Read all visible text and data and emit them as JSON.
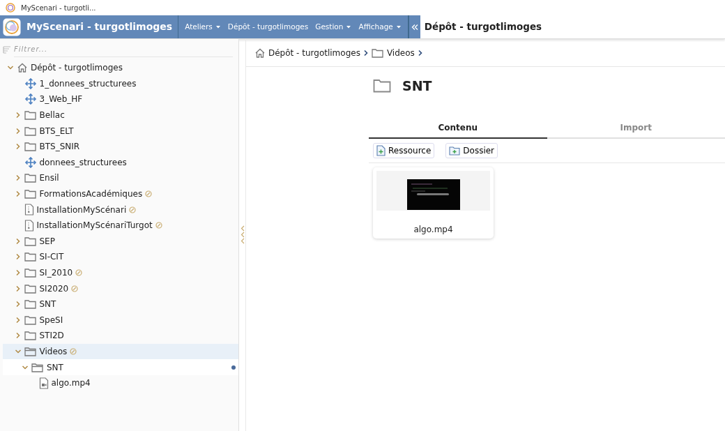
{
  "browser_tab": {
    "title": "MyScenari - turgotli..."
  },
  "header": {
    "app_title": "MyScenari - turgotlimoges",
    "menu": [
      {
        "label": "Ateliers",
        "dropdown": true
      },
      {
        "label": "Dépôt - turgotlimoges",
        "dropdown": false
      },
      {
        "label": "Gestion",
        "dropdown": true
      },
      {
        "label": "Affichage",
        "dropdown": true
      }
    ],
    "page_title": "Dépôt - turgotlimoges"
  },
  "sidebar": {
    "filter": {
      "placeholder": "Filtrer..."
    },
    "tree": [
      {
        "label": "Dépôt - turgotlimoges",
        "kind": "home",
        "expanded": true,
        "selected": false,
        "edited": false,
        "current": false,
        "children": [
          {
            "label": "1_donnees_structurees",
            "kind": "space",
            "selected": false,
            "edited": false,
            "current": false
          },
          {
            "label": "3_Web_HF",
            "kind": "space",
            "selected": false,
            "edited": false,
            "current": false
          },
          {
            "label": "Bellac",
            "kind": "folder",
            "expanded": false,
            "selected": false,
            "edited": false,
            "current": false
          },
          {
            "label": "BTS_ELT",
            "kind": "folder",
            "expanded": false,
            "selected": false,
            "edited": false,
            "current": false
          },
          {
            "label": "BTS_SNIR",
            "kind": "folder",
            "expanded": false,
            "selected": false,
            "edited": false,
            "current": false
          },
          {
            "label": "donnees_structurees",
            "kind": "space",
            "selected": false,
            "edited": false,
            "current": false
          },
          {
            "label": "Ensil",
            "kind": "folder",
            "expanded": false,
            "selected": false,
            "edited": false,
            "current": false
          },
          {
            "label": "FormationsAcadémiques",
            "kind": "folder",
            "expanded": false,
            "selected": false,
            "edited": true,
            "current": false
          },
          {
            "label": "InstallationMyScénari",
            "kind": "document",
            "selected": false,
            "edited": true,
            "current": false
          },
          {
            "label": "InstallationMyScénariTurgot",
            "kind": "document",
            "selected": false,
            "edited": true,
            "current": false
          },
          {
            "label": "SEP",
            "kind": "folder",
            "expanded": false,
            "selected": false,
            "edited": false,
            "current": false
          },
          {
            "label": "SI-CIT",
            "kind": "folder",
            "expanded": false,
            "selected": false,
            "edited": false,
            "current": false
          },
          {
            "label": "SI_2010",
            "kind": "folder",
            "expanded": false,
            "selected": false,
            "edited": true,
            "current": false
          },
          {
            "label": "SI2020",
            "kind": "folder",
            "expanded": false,
            "selected": false,
            "edited": true,
            "current": false
          },
          {
            "label": "SNT",
            "kind": "folder",
            "expanded": false,
            "selected": false,
            "edited": false,
            "current": false
          },
          {
            "label": "SpeSI",
            "kind": "folder",
            "expanded": false,
            "selected": false,
            "edited": false,
            "current": false
          },
          {
            "label": "STI2D",
            "kind": "folder",
            "expanded": false,
            "selected": false,
            "edited": false,
            "current": false
          },
          {
            "label": "Videos",
            "kind": "folder",
            "expanded": true,
            "selected": true,
            "edited": true,
            "current": false,
            "children": [
              {
                "label": "SNT",
                "kind": "folder",
                "expanded": true,
                "selected": false,
                "edited": false,
                "current": true,
                "children": [
                  {
                    "label": "algo.mp4",
                    "kind": "video",
                    "selected": false,
                    "edited": false,
                    "current": false
                  }
                ]
              }
            ]
          }
        ]
      }
    ]
  },
  "breadcrumb": [
    {
      "label": "Dépôt - turgotlimoges",
      "kind": "home"
    },
    {
      "label": "Videos",
      "kind": "folder"
    }
  ],
  "content": {
    "title": "SNT",
    "tabs": [
      {
        "label": "Contenu",
        "selected": true
      },
      {
        "label": "Import",
        "selected": false
      }
    ],
    "buttons": [
      {
        "label": "Ressource",
        "kind": "resource"
      },
      {
        "label": "Dossier",
        "kind": "folder"
      }
    ],
    "files": [
      {
        "name": "algo.mp4",
        "kind": "video"
      }
    ]
  }
}
